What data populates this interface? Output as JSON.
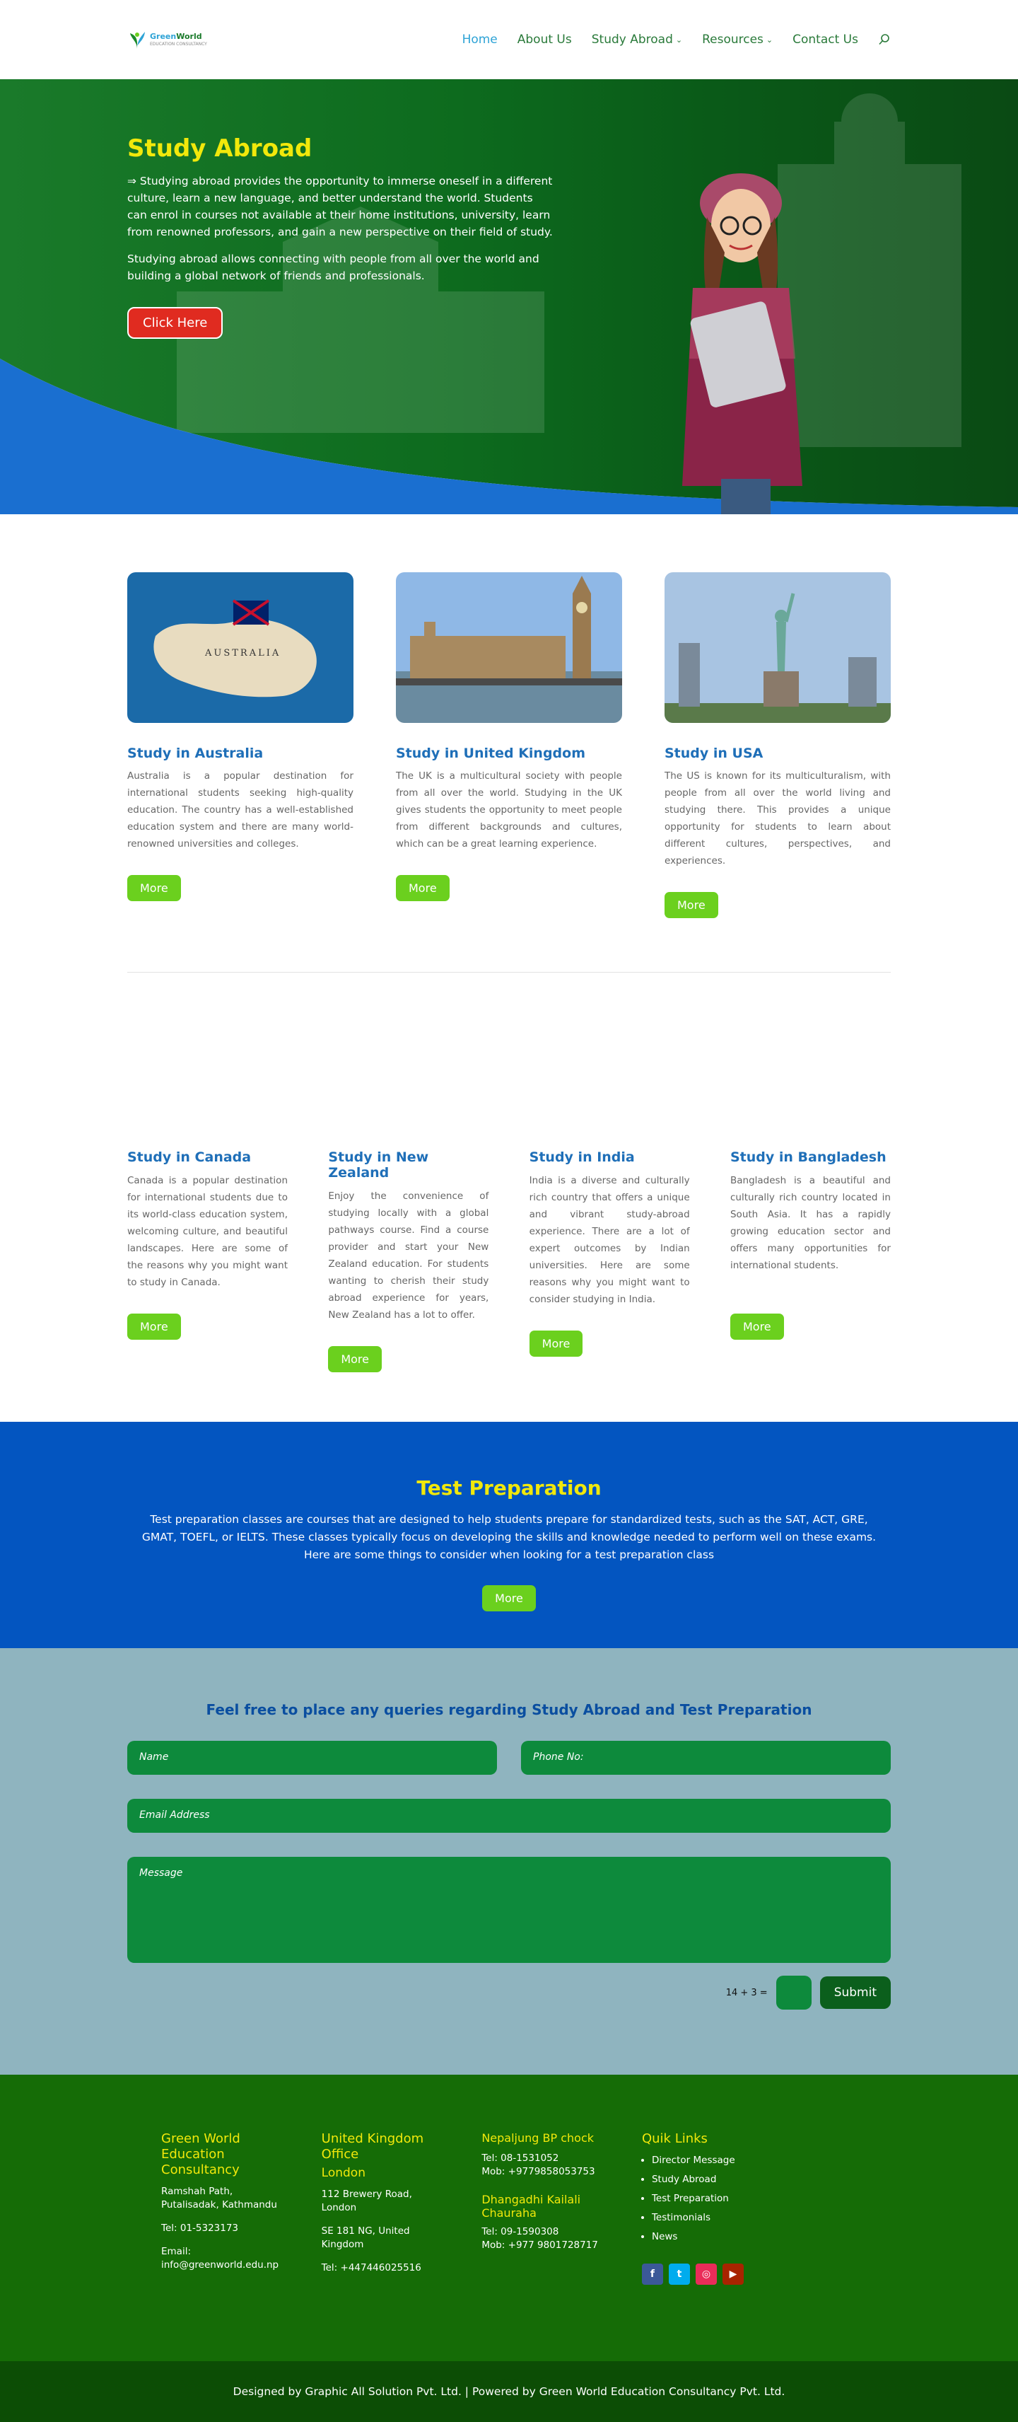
{
  "header": {
    "logo_line1": "Green",
    "logo_line2": "World",
    "logo_sub": "EDUCATION CONSULTANCY",
    "nav": [
      {
        "label": "Home"
      },
      {
        "label": "About Us"
      },
      {
        "label": "Study Abroad"
      },
      {
        "label": "Resources"
      },
      {
        "label": "Contact Us"
      }
    ]
  },
  "hero": {
    "title": "Study Abroad",
    "p1": "⇒ Studying abroad provides the opportunity to immerse oneself in a different culture, learn a new language, and better understand the world. Students can enrol in courses not available at their home institutions, university, learn from renowned professors, and gain a new perspective on their field of study.",
    "p2": "Studying abroad allows connecting with people from all over the world and building a global network of friends and professionals.",
    "button": "Click Here"
  },
  "cards_top": [
    {
      "title": "Study in Australia",
      "text": "Australia is a popular destination for international students seeking high-quality education. The country has a well-established education system and there are many world-renowned universities and colleges.",
      "button": "More"
    },
    {
      "title": "Study in United Kingdom",
      "text": "The UK is a multicultural society with people from all over the world. Studying in the UK gives students the opportunity to meet people from different backgrounds and cultures, which can be a great learning experience.",
      "button": "More"
    },
    {
      "title": "Study in USA",
      "text": "The US is known for its multiculturalism, with people from all over the world living and studying there. This provides a unique opportunity for students to learn about different cultures, perspectives, and experiences.",
      "button": "More"
    }
  ],
  "cards_bottom": [
    {
      "title": "Study in Canada",
      "text": "Canada is a popular destination for international students due to its world-class education system, welcoming culture, and beautiful landscapes. Here are some of the reasons why you might want to study in Canada.",
      "button": "More"
    },
    {
      "title": "Study in New Zealand",
      "text": "Enjoy the convenience of studying locally with a global pathways course. Find a course provider and start your New Zealand education. For students wanting to cherish their study abroad experience for years, New Zealand has a lot to offer.",
      "button": "More"
    },
    {
      "title": "Study in India",
      "text": "India is a diverse and culturally rich country that offers a unique and vibrant study-abroad experience. There are a lot of expert outcomes by Indian universities. Here are some reasons why you might want to consider studying in India.",
      "button": "More"
    },
    {
      "title": "Study in Bangladesh",
      "text": "Bangladesh is a beautiful and culturally rich country located in South Asia. It has a rapidly growing education sector and offers many opportunities for international students.",
      "button": "More"
    }
  ],
  "testprep": {
    "title": "Test Preparation",
    "text": "Test preparation classes are courses that are designed to help students prepare for standardized tests, such as the SAT, ACT, GRE, GMAT, TOEFL, or IELTS. These classes typically focus on developing the skills and knowledge needed to perform well on these exams. Here are some things to consider when looking for a test preparation class",
    "button": "More"
  },
  "form": {
    "title": "Feel free to place any queries regarding Study Abroad and Test Preparation",
    "name_placeholder": "Name",
    "phone_placeholder": "Phone No:",
    "email_placeholder": "Email Address",
    "message_placeholder": "Message",
    "captcha": "14 + 3 =",
    "submit": "Submit"
  },
  "footer": {
    "col1": {
      "heading": "Green World Education Consultancy",
      "address": "Ramshah Path, Putalisadak, Kathmandu",
      "tel": "Tel: 01-5323173",
      "email_label": "Email:",
      "email": "info@greenworld.edu.np"
    },
    "col2": {
      "heading": "United Kingdom Office",
      "sub": "London",
      "addr1": "112 Brewery Road, London",
      "addr2": "SE 181 NG, United Kingdom",
      "tel": "Tel: +447446025516"
    },
    "col3": {
      "heading": "Nepaljung BP chock",
      "tel": "Tel: 08-1531052",
      "mob": "Mob: +9779858053753",
      "heading2": "Dhangadhi Kailali Chauraha",
      "tel2": "Tel: 09-1590308",
      "mob2": "Mob: +977 9801728717"
    },
    "col4": {
      "heading": "Quik Links",
      "links": [
        "Director Message",
        "Study Abroad",
        "Test Preparation",
        "Testimonials",
        "News"
      ]
    },
    "social": [
      {
        "name": "facebook",
        "glyph": "f",
        "color": "#3b5998"
      },
      {
        "name": "twitter",
        "glyph": "t",
        "color": "#00acee"
      },
      {
        "name": "instagram",
        "glyph": "◎",
        "color": "#ea2c59"
      },
      {
        "name": "youtube",
        "glyph": "▶",
        "color": "#a82400"
      }
    ],
    "copyright": "Designed by Graphic All Solution Pvt. Ltd. | Powered by Green World Education Consultancy Pvt. Ltd."
  }
}
